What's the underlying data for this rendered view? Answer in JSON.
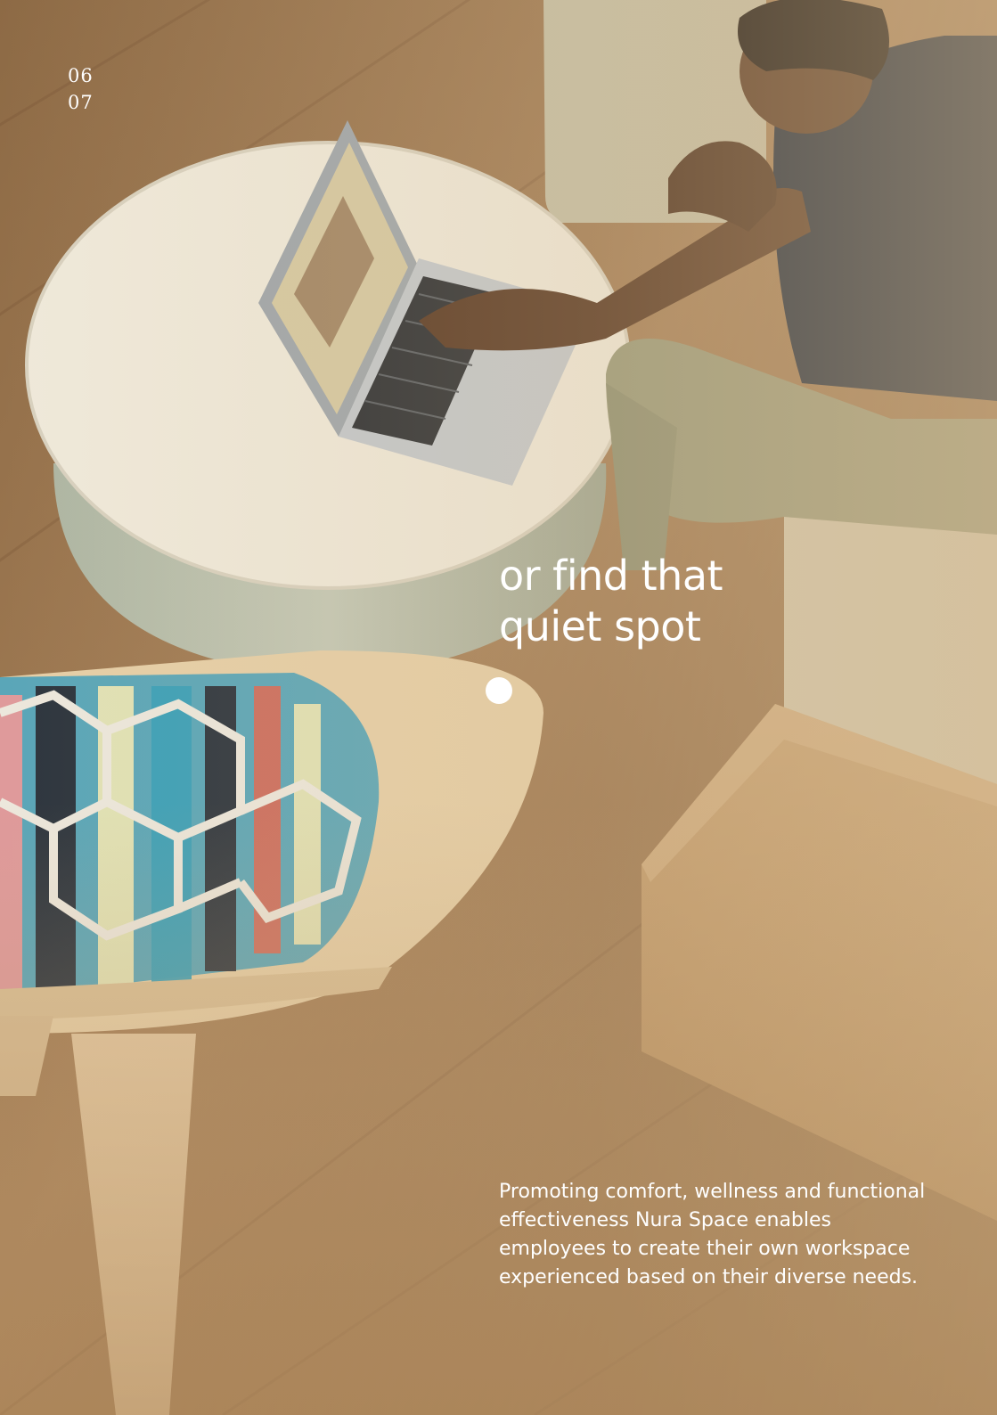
{
  "page_numbers": {
    "current": "06",
    "next": "07"
  },
  "headline": {
    "line1": "or find that",
    "line2": "quiet spot"
  },
  "body": {
    "text": "Promoting comfort, wellness and functional effectiveness Nura Space enables employees to create their own workspace experienced based on their diverse needs."
  },
  "colors": {
    "text": "#ffffff",
    "floor": "#a57f55",
    "table": "#efe9da",
    "ottoman": "#b8bfae",
    "sofa": "#c9c3a8",
    "chair_wood": "#e6cfa7",
    "shirt": "#1f2a3a",
    "pants": "#9a9a7a",
    "skin": "#5a3a24",
    "laptop": "#b9bec3",
    "side_block": "#c9a474"
  },
  "icons": {
    "marker": "dot-icon"
  }
}
